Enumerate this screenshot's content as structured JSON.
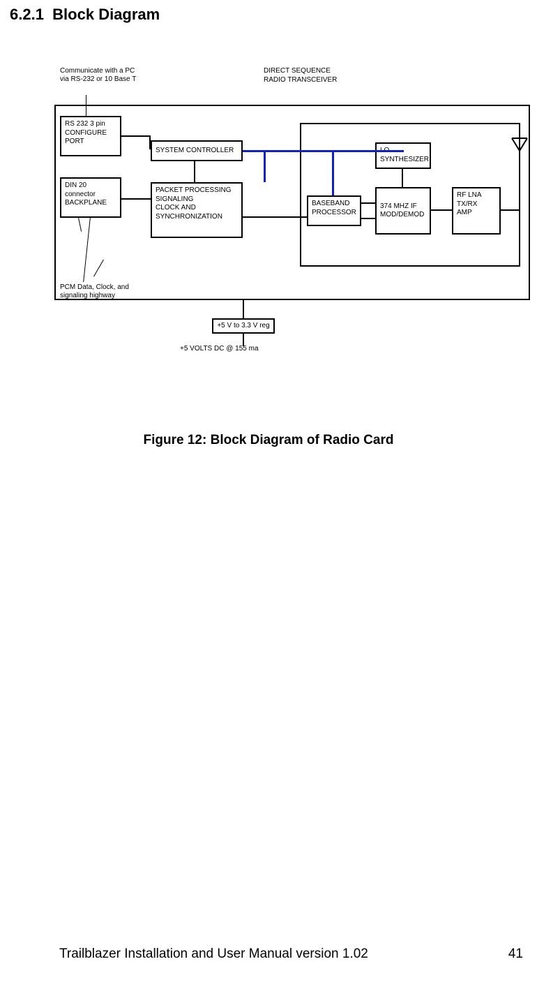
{
  "section_number": "6.2.1",
  "section_title": "Block Diagram",
  "caption": "Figure 12: Block Diagram of Radio Card",
  "footer_text": "Trailblazer Installation and User Manual version 1.02",
  "page_number": "41",
  "diagram": {
    "note_comm": "Communicate with a PC via RS-232 or 10 Base T",
    "note_pcm": "PCM Data, Clock, and signaling highway",
    "transceiver_group_label": "DIRECT SEQUENCE\nRADIO TRANSCEIVER",
    "blocks": {
      "config_port": "RS 232 3 pin\nCONFIGURE\nPORT",
      "backplane": "DIN 20\nconnector\nBACKPLANE",
      "sys_controller": "SYSTEM CONTROLLER",
      "packet": "PACKET PROCESSING\nSIGNALING\nCLOCK AND\nSYNCHRONIZATION",
      "baseband": "BASEBAND\nPROCESSOR",
      "lo_syn": "LO\nSYNTHESIZER",
      "if_mod": "374 MHZ IF\nMOD/DEMOD",
      "rf_lna": "RF LNA\nTX/RX\nAMP",
      "reg": "+5 V to 3.3 V reg"
    },
    "power_label": "+5 VOLTS DC @ 155 ma"
  }
}
